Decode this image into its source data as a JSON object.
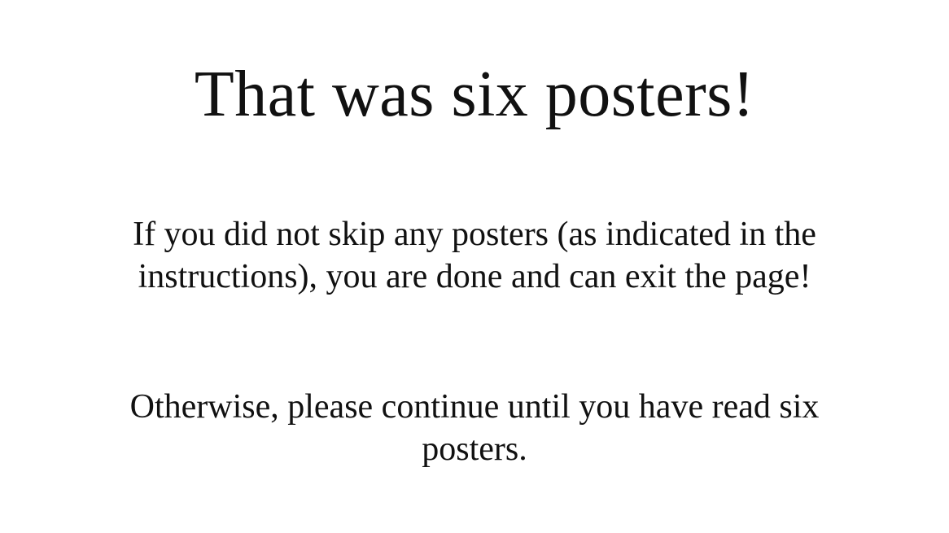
{
  "slide": {
    "title": "That was six posters!",
    "paragraph_1": "If you did not skip any posters (as indicated in the instructions), you are done and can exit the page!",
    "paragraph_2": "Otherwise, please continue until you have read six posters."
  }
}
